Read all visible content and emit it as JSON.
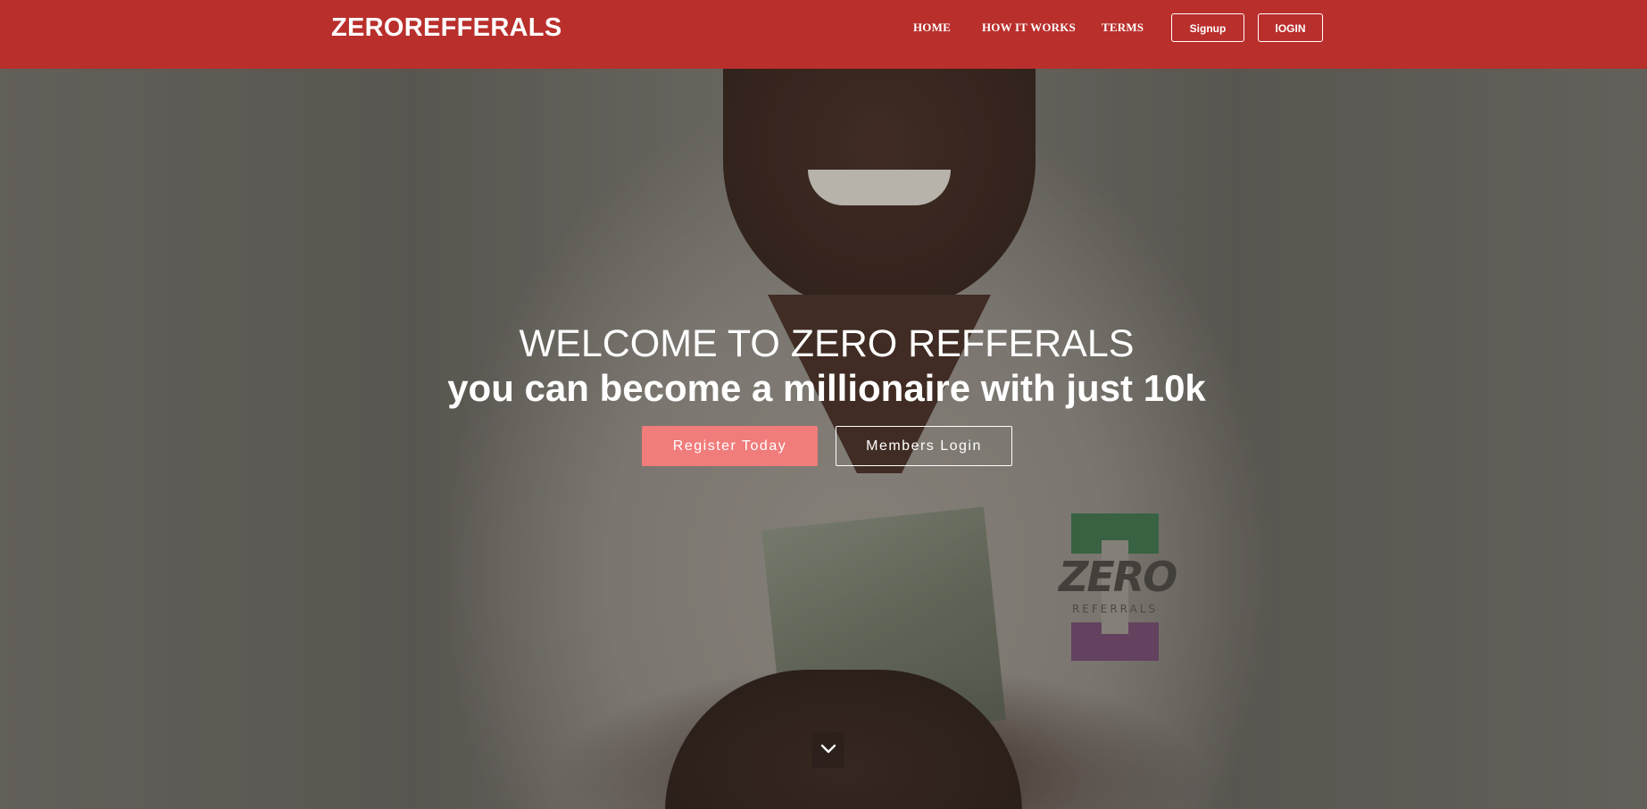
{
  "navbar": {
    "brand": "ZEROREFFERALS",
    "links": [
      {
        "label": "HOME"
      },
      {
        "label": "HOW IT WORKS"
      },
      {
        "label": "TERMS"
      }
    ],
    "signup_label": "Signup",
    "login_label": "lOGIN",
    "background_color": "#b92f2c"
  },
  "hero": {
    "title": "WELCOME TO ZERO REFFERALS",
    "subtitle": "you can become a millionaire with just 10k",
    "register_label": "Register Today",
    "members_login_label": "Members Login",
    "register_color": "#f07c7b",
    "scroll_icon": "chevron-down-icon"
  },
  "shirt_logo": {
    "word": "ZERO",
    "sub": "REFERRALS"
  }
}
